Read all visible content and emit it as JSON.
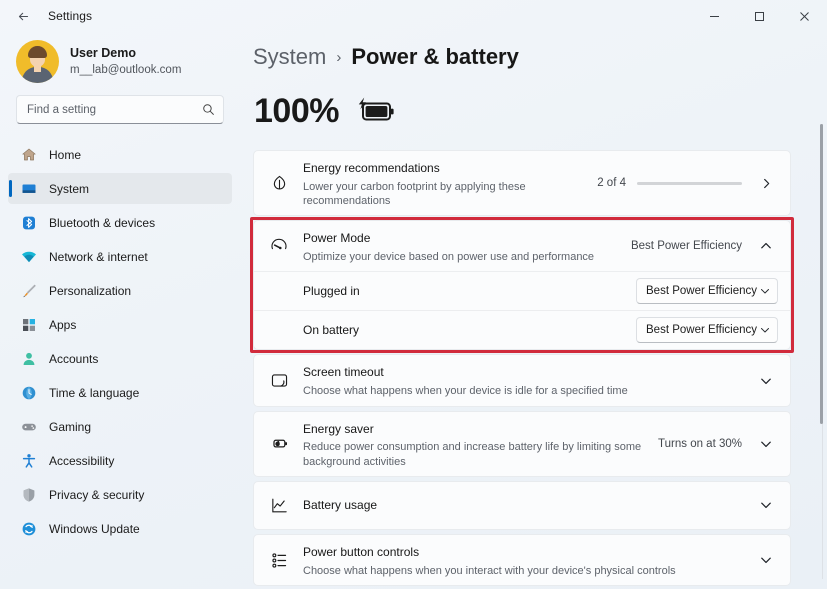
{
  "window": {
    "title": "Settings",
    "back_icon": "back-arrow-icon",
    "minimize_label": "–",
    "maximize_label": "□",
    "close_label": "✕"
  },
  "account": {
    "name": "User Demo",
    "email": "m__lab@outlook.com",
    "avatar_color": "#f0bc2a"
  },
  "search": {
    "placeholder": "Find a setting",
    "value": "",
    "icon": "search-icon"
  },
  "sidebar": {
    "items": [
      {
        "label": "Home",
        "icon": "home-icon",
        "active": false
      },
      {
        "label": "System",
        "icon": "monitor-icon",
        "active": true
      },
      {
        "label": "Bluetooth & devices",
        "icon": "bluetooth-icon",
        "active": false
      },
      {
        "label": "Network & internet",
        "icon": "wifi-icon",
        "active": false
      },
      {
        "label": "Personalization",
        "icon": "paintbrush-icon",
        "active": false
      },
      {
        "label": "Apps",
        "icon": "apps-grid-icon",
        "active": false
      },
      {
        "label": "Accounts",
        "icon": "person-icon",
        "active": false
      },
      {
        "label": "Time & language",
        "icon": "clock-globe-icon",
        "active": false
      },
      {
        "label": "Gaming",
        "icon": "gamepad-icon",
        "active": false
      },
      {
        "label": "Accessibility",
        "icon": "accessibility-icon",
        "active": false
      },
      {
        "label": "Privacy & security",
        "icon": "shield-icon",
        "active": false
      },
      {
        "label": "Windows Update",
        "icon": "update-refresh-icon",
        "active": false
      }
    ]
  },
  "breadcrumb": {
    "parent": "System",
    "separator": "›",
    "current": "Power & battery"
  },
  "battery": {
    "percent_label": "100%",
    "icon": "battery-charging-icon"
  },
  "cards": {
    "energy_recommendations": {
      "icon": "leaf-icon",
      "title": "Energy recommendations",
      "subtitle": "Lower your carbon footprint by applying these recommendations",
      "count_label": "2 of 4",
      "progress_percent": 50,
      "progress_fill_color": "#0c72c0",
      "progress_track_color": "#d2d4d7",
      "chevron": "chevron-right-icon"
    },
    "power_mode": {
      "icon": "speedometer-icon",
      "title": "Power Mode",
      "subtitle": "Optimize your device based on power use and performance",
      "value": "Best Power Efficiency",
      "chevron": "chevron-up-icon",
      "expanded": true,
      "rows": [
        {
          "label": "Plugged in",
          "value": "Best Power Efficiency",
          "chevron": "chevron-down-icon"
        },
        {
          "label": "On battery",
          "value": "Best Power Efficiency",
          "chevron": "chevron-down-icon"
        }
      ]
    },
    "screen_timeout": {
      "icon": "screen-timeout-icon",
      "title": "Screen timeout",
      "subtitle": "Choose what happens when your device is idle for a specified time",
      "value": "",
      "chevron": "chevron-down-icon"
    },
    "energy_saver": {
      "icon": "battery-leaf-icon",
      "title": "Energy saver",
      "subtitle": "Reduce power consumption and increase battery life by limiting some background activities",
      "value": "Turns on at 30%",
      "chevron": "chevron-down-icon"
    },
    "battery_usage": {
      "icon": "line-chart-icon",
      "title": "Battery usage",
      "subtitle": "",
      "value": "",
      "chevron": "chevron-down-icon"
    },
    "power_button_controls": {
      "icon": "list-controls-icon",
      "title": "Power button controls",
      "subtitle": "Choose what happens when you interact with your device's physical controls",
      "value": "",
      "chevron": "chevron-down-icon"
    }
  },
  "annotation": {
    "highlight_color": "#d12b3c",
    "target": "power-mode-card"
  }
}
